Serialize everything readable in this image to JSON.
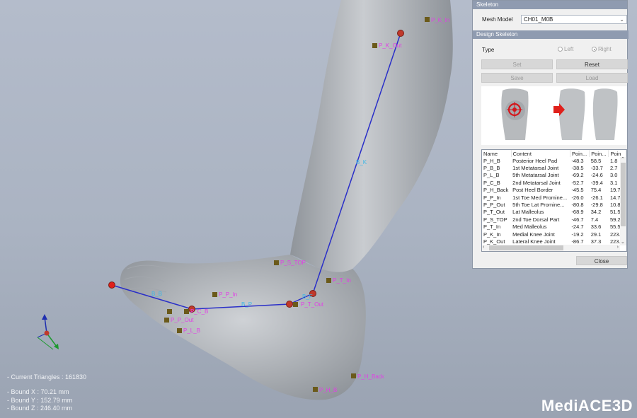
{
  "viewport": {
    "info": {
      "triangles": "- Current Triangles : 161830",
      "bound_x": "- Bound X : 70.21 mm",
      "bound_y": "- Bound Y : 152.79 mm",
      "bound_z": "- Bound Z : 246.40 mm"
    },
    "logo_main": "MediACE",
    "logo_suffix": "3D",
    "landmarks": [
      "P_K_In",
      "P_K_Out",
      "P_S_TOP",
      "P_T_In",
      "P_P_In",
      "P_T_Out",
      "P_C_B",
      "P_P_Out",
      "P_L_B",
      "P_H_Back",
      "P_H_B"
    ],
    "segment_labels": [
      "B_K",
      "B_F",
      "B_P",
      "B_B"
    ]
  },
  "panel": {
    "title": "Skeleton",
    "mesh_model_label": "Mesh Model",
    "mesh_model_value": "CH01_M0B",
    "design_title": "Design Skeleton",
    "type_label": "Type",
    "type_options": [
      "Left",
      "Right"
    ],
    "type_selected": "Right",
    "buttons": {
      "set": "Set",
      "reset": "Reset",
      "save": "Save",
      "load": "Load",
      "close": "Close"
    },
    "table": {
      "columns": [
        "Name",
        "Content",
        "Poin...",
        "Poin...",
        "Poin"
      ],
      "rows": [
        [
          "P_H_B",
          "Posterior Heel Pad",
          "-48.3",
          "58.5",
          "1.8"
        ],
        [
          "P_B_B",
          "1st Metatarsal Joint",
          "-38.5",
          "-33.7",
          "2.7"
        ],
        [
          "P_L_B",
          "5th Metatarsal Joint",
          "-69.2",
          "-24.6",
          "3.0"
        ],
        [
          "P_C_B",
          "2nd Metatarsal Joint",
          "-52.7",
          "-39.4",
          "3.1"
        ],
        [
          "P_H_Back",
          "Post Heel Border",
          "-45.5",
          "75.4",
          "19.7"
        ],
        [
          "P_P_In",
          "1st Toe Med Promine...",
          "-26.0",
          "-26.1",
          "14.7"
        ],
        [
          "P_P_Out",
          "5th Toe Lat Promine...",
          "-80.8",
          "-29.8",
          "10.8"
        ],
        [
          "P_T_Out",
          "Lat Malleolus",
          "-68.9",
          "34.2",
          "51.5"
        ],
        [
          "P_S_TOP",
          "2nd Toe Dorsal Part",
          "-46.7",
          "7.4",
          "59.2"
        ],
        [
          "P_T_In",
          "Med Malleolus",
          "-24.7",
          "33.6",
          "55.5"
        ],
        [
          "P_K_In",
          "Medial Knee Joint",
          "-19.2",
          "29.1",
          "223."
        ],
        [
          "P_K_Out",
          "Lateral Knee Joint",
          "-86.7",
          "37.3",
          "223."
        ]
      ]
    }
  }
}
